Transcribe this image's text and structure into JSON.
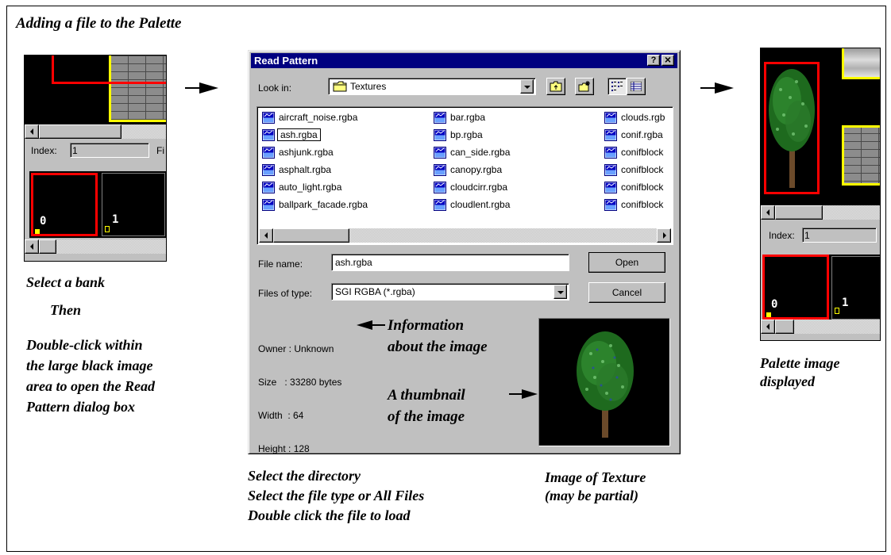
{
  "figure": {
    "title": "Adding a file to the Palette"
  },
  "left_panel": {
    "index_label": "Index:",
    "index_value": "1",
    "cut_label": "Fi",
    "bank_labels": [
      "0",
      "1"
    ]
  },
  "left_caption": {
    "line1": "Select a bank",
    "line2": "Then",
    "line3": "Double-click within",
    "line4": "the large black image",
    "line5": "area to open the Read",
    "line6": "Pattern dialog box"
  },
  "dialog": {
    "title": "Read Pattern",
    "help_button": "?",
    "close_button": "×",
    "look_in_label": "Look in:",
    "look_in_value": "Textures",
    "files": {
      "col1": [
        "aircraft_noise.rgba",
        "ash.rgba",
        "ashjunk.rgba",
        "asphalt.rgba",
        "auto_light.rgba",
        "ballpark_facade.rgba"
      ],
      "col2": [
        "bar.rgba",
        "bp.rgba",
        "can_side.rgba",
        "canopy.rgba",
        "cloudcirr.rgba",
        "cloudlent.rgba"
      ],
      "col3": [
        "clouds.rgb",
        "conif.rgba",
        "conifblock",
        "conifblock",
        "conifblock",
        "conifblock"
      ]
    },
    "file_name_label": "File name:",
    "file_name_value": "ash.rgba",
    "files_of_type_label": "Files of type:",
    "files_of_type_value": "SGI RGBA (*.rgba)",
    "open_button": "Open",
    "cancel_button": "Cancel",
    "info": {
      "owner": "Owner : Unknown",
      "size": "Size   : 33280 bytes",
      "width": "Width  : 64",
      "height": "Height : 128"
    }
  },
  "annotations": {
    "info_line1": "Information",
    "info_line2": "about the image",
    "thumb_line1": "A thumbnail",
    "thumb_line2": "of the image"
  },
  "bottom_captions": {
    "line1": "Select the directory",
    "line2": "Select the file type or All Files",
    "line3": "Double click the file to load",
    "texture_line1": "Image of Texture",
    "texture_line2": "(may be partial)"
  },
  "right_panel": {
    "index_label": "Index:",
    "index_value": "1",
    "bank_labels": [
      "0",
      "1"
    ]
  },
  "right_caption": {
    "line1": "Palette image",
    "line2": "displayed"
  },
  "colors": {
    "dialog_title_bar": "#000080",
    "selection_red": "#ff0000",
    "selection_yellow": "#ffff00",
    "win_gray": "#c0c0c0"
  }
}
